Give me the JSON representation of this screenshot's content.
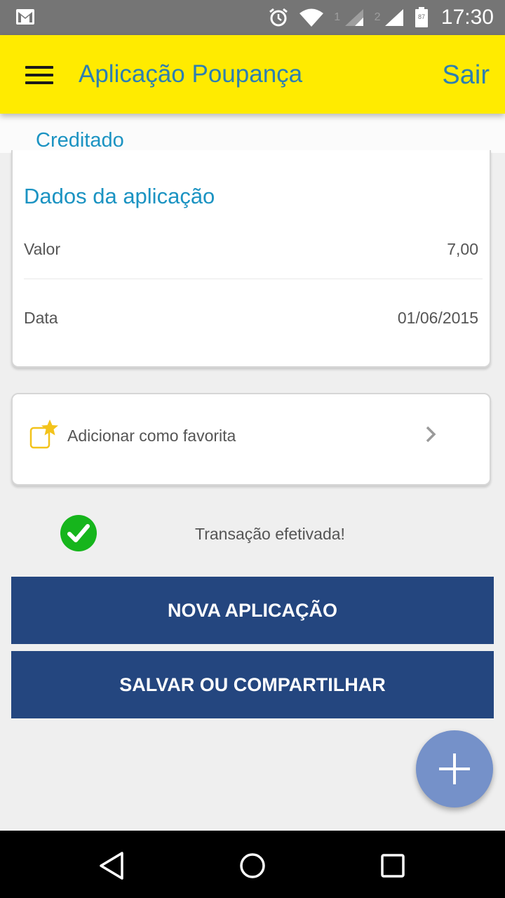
{
  "status_bar": {
    "time": "17:30",
    "battery": "87",
    "sim1": "1",
    "sim2": "2"
  },
  "header": {
    "title": "Aplicação Poupança",
    "logout_label": "Sair"
  },
  "status_label": "Creditado",
  "details": {
    "title": "Dados da aplicação",
    "rows": [
      {
        "label": "Valor",
        "value": "7,00"
      },
      {
        "label": "Data",
        "value": "01/06/2015"
      }
    ]
  },
  "favorite": {
    "label": "Adicionar como favorita"
  },
  "success_message": "Transação efetivada!",
  "actions": {
    "new_label": "NOVA APLICAÇÃO",
    "save_share_label": "SALVAR OU COMPARTILHAR"
  },
  "icons": {
    "menu": "hamburger-menu-icon",
    "favorite": "favorite-star-icon",
    "chevron": "chevron-right-icon",
    "check": "check-circle-icon",
    "fab": "plus-icon"
  },
  "colors": {
    "app_bar": "#ffeb00",
    "accent": "#1b93c2",
    "primary_button": "#24467f",
    "success": "#16b51c",
    "fab": "#7591c9"
  }
}
